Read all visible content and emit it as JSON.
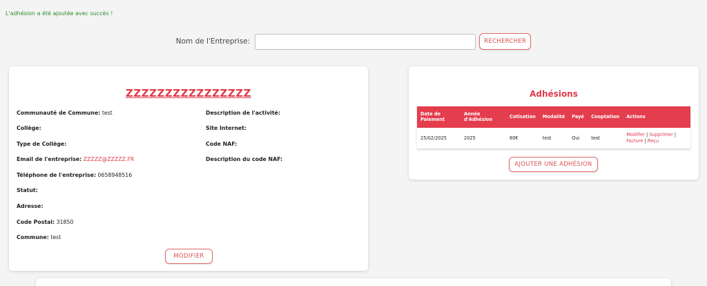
{
  "flash": {
    "message": "L'adhésion a été ajoutée avec succès !"
  },
  "search": {
    "label": "Nom de l'Entreprise:",
    "value": "",
    "placeholder": "",
    "button_label": "Rechercher"
  },
  "company": {
    "name": "ZZZZZZZZZZZZZZZZ",
    "left_fields": [
      {
        "label": "Communauté de Commune:",
        "value": "test"
      },
      {
        "label": "Collège:",
        "value": ""
      },
      {
        "label": "Type de Collège:",
        "value": ""
      },
      {
        "label": "Email de l'entreprise:",
        "value": "ZZZZZ@ZZZZZ.FR"
      },
      {
        "label": "Téléphone de l'entreprise:",
        "value": "0658948516"
      },
      {
        "label": "Statut:",
        "value": ""
      },
      {
        "label": "Adresse:",
        "value": ""
      },
      {
        "label": "Code Postal:",
        "value": "31850"
      },
      {
        "label": "Commune:",
        "value": "test"
      }
    ],
    "right_fields": [
      {
        "label": "Description de l'activité:",
        "value": ""
      },
      {
        "label": "Site Internet:",
        "value": ""
      },
      {
        "label": "Code NAF:",
        "value": ""
      },
      {
        "label": "Description du code NAF:",
        "value": ""
      }
    ],
    "modify_label": "Modifier"
  },
  "adhesions": {
    "title": "Adhésions",
    "columns": [
      "Date de Paiement",
      "Année d'Adhésion",
      "Cotisation",
      "Modalité",
      "Payé",
      "Cooptation",
      "Actions"
    ],
    "rows": [
      {
        "date": "25/02/2025",
        "annee": "2025",
        "cotisation": "80€",
        "modalite": "test",
        "paye": "Oui",
        "cooptation": "test",
        "actions": {
          "modifier": "Modifier",
          "supprimer": "Supprimer",
          "facture": "Facture",
          "recu": "Reçu",
          "separator": "|"
        }
      }
    ],
    "add_label": "Ajouter une adhésion"
  },
  "colors": {
    "accent": "#e43d4e",
    "success": "#2a8a2a",
    "background": "#f4f4f4"
  }
}
